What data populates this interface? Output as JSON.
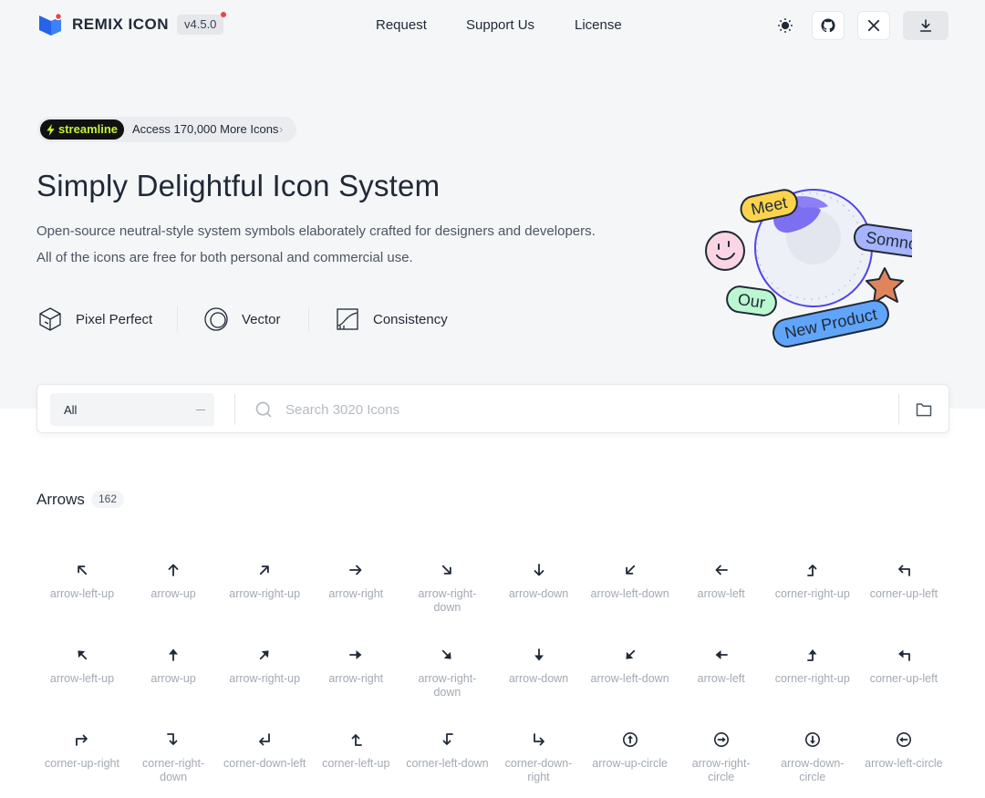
{
  "header": {
    "brand": "REMIX ICON",
    "version": "v4.5.0",
    "nav": [
      "Request",
      "Support Us",
      "License"
    ],
    "buttons": [
      "sun-icon",
      "github-icon",
      "x-icon",
      "download-icon"
    ]
  },
  "hero": {
    "promo_badge": "streamline",
    "promo_text": "Access 170,000 More Icons",
    "title": "Simply Delightful Icon System",
    "subtitle_1": "Open-source neutral-style system symbols elaborately crafted for designers and developers.",
    "subtitle_2": "All of the icons are free for both personal and commercial use.",
    "features": [
      "Pixel Perfect",
      "Vector",
      "Consistency"
    ],
    "illustration_tags": [
      "Meet",
      "Somno",
      "Our",
      "New Product"
    ]
  },
  "search": {
    "category_value": "All",
    "placeholder": "Search 3020 Icons"
  },
  "category": {
    "title": "Arrows",
    "count": "162",
    "rows": [
      [
        {
          "icon": "arrow-left-up-line",
          "label": "arrow-left-up"
        },
        {
          "icon": "arrow-up-line",
          "label": "arrow-up"
        },
        {
          "icon": "arrow-right-up-line",
          "label": "arrow-right-up"
        },
        {
          "icon": "arrow-right-line",
          "label": "arrow-right"
        },
        {
          "icon": "arrow-right-down-line",
          "label": "arrow-right-down"
        },
        {
          "icon": "arrow-down-line",
          "label": "arrow-down"
        },
        {
          "icon": "arrow-left-down-line",
          "label": "arrow-left-down"
        },
        {
          "icon": "arrow-left-line",
          "label": "arrow-left"
        },
        {
          "icon": "corner-right-up-line",
          "label": "corner-right-up"
        },
        {
          "icon": "corner-up-left-line",
          "label": "corner-up-left"
        }
      ],
      [
        {
          "icon": "arrow-left-up-fill",
          "label": "arrow-left-up"
        },
        {
          "icon": "arrow-up-fill",
          "label": "arrow-up"
        },
        {
          "icon": "arrow-right-up-fill",
          "label": "arrow-right-up"
        },
        {
          "icon": "arrow-right-fill",
          "label": "arrow-right"
        },
        {
          "icon": "arrow-right-down-fill",
          "label": "arrow-right-down"
        },
        {
          "icon": "arrow-down-fill",
          "label": "arrow-down"
        },
        {
          "icon": "arrow-left-down-fill",
          "label": "arrow-left-down"
        },
        {
          "icon": "arrow-left-fill",
          "label": "arrow-left"
        },
        {
          "icon": "corner-right-up-fill",
          "label": "corner-right-up"
        },
        {
          "icon": "corner-up-left-fill",
          "label": "corner-up-left"
        }
      ],
      [
        {
          "icon": "corner-up-right",
          "label": "corner-up-right"
        },
        {
          "icon": "corner-right-down",
          "label": "corner-right-down"
        },
        {
          "icon": "corner-down-left",
          "label": "corner-down-left"
        },
        {
          "icon": "corner-left-up",
          "label": "corner-left-up"
        },
        {
          "icon": "corner-left-down",
          "label": "corner-left-down"
        },
        {
          "icon": "corner-down-right",
          "label": "corner-down-right"
        },
        {
          "icon": "arrow-up-circle",
          "label": "arrow-up-circle"
        },
        {
          "icon": "arrow-right-circle",
          "label": "arrow-right-circle"
        },
        {
          "icon": "arrow-down-circle",
          "label": "arrow-down-circle"
        },
        {
          "icon": "arrow-left-circle",
          "label": "arrow-left-circle"
        }
      ]
    ]
  },
  "colors": {
    "accent": "#2563eb",
    "text": "#1f2937",
    "muted": "#a3a9b2",
    "hero_bg": "#f5f6f8",
    "promo_badge_text": "#c6f432"
  }
}
